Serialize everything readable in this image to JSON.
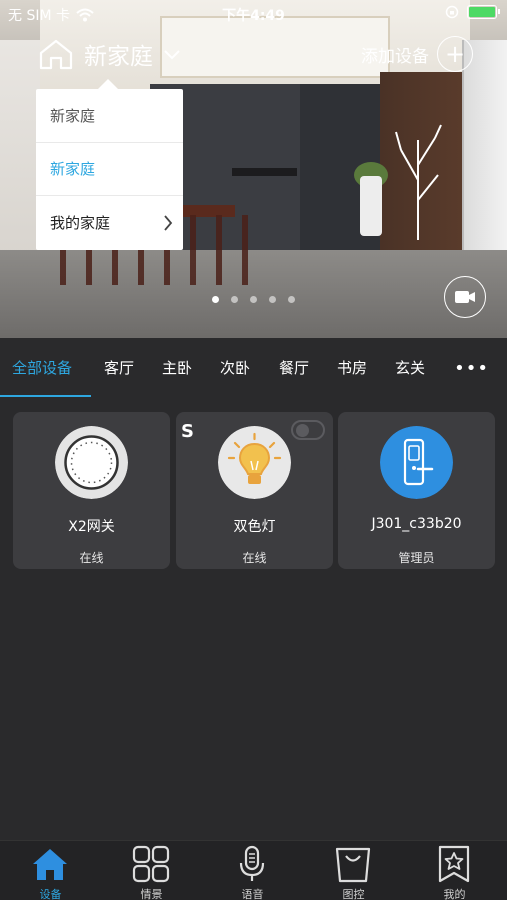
{
  "status_bar": {
    "carrier": "无 SIM 卡",
    "time": "下午4:49"
  },
  "header": {
    "home_name": "新家庭",
    "add_device_label": "添加设备"
  },
  "dropdown": {
    "items": [
      {
        "label": "新家庭"
      },
      {
        "label": "新家庭",
        "selected": true
      },
      {
        "label": "我的家庭"
      }
    ]
  },
  "banner": {
    "page_count": 5,
    "active_page": 1
  },
  "tabs": {
    "items": [
      "全部设备",
      "客厅",
      "主卧",
      "次卧",
      "餐厅",
      "书房",
      "玄关"
    ],
    "active": "全部设备"
  },
  "devices": [
    {
      "name": "X2网关",
      "status": "在线",
      "icon": "gateway-icon"
    },
    {
      "name": "双色灯",
      "status": "在线",
      "icon": "light-bulb-icon",
      "badge": "S"
    },
    {
      "name": "J301_c33b20",
      "status": "管理员",
      "icon": "door-lock-icon"
    }
  ],
  "bottom_nav": {
    "items": [
      {
        "label": "设备",
        "icon": "home-icon",
        "active": true
      },
      {
        "label": "情景",
        "icon": "grid-icon"
      },
      {
        "label": "语音",
        "icon": "microphone-icon"
      },
      {
        "label": "图控",
        "icon": "shopping-bag-icon"
      },
      {
        "label": "我的",
        "icon": "bookmark-star-icon"
      }
    ]
  },
  "colors": {
    "accent": "#2ea7e0",
    "background": "#2a2a2c",
    "card": "#3d3d40",
    "bulb": "#e8a33d",
    "lock": "#2e8fe0"
  }
}
